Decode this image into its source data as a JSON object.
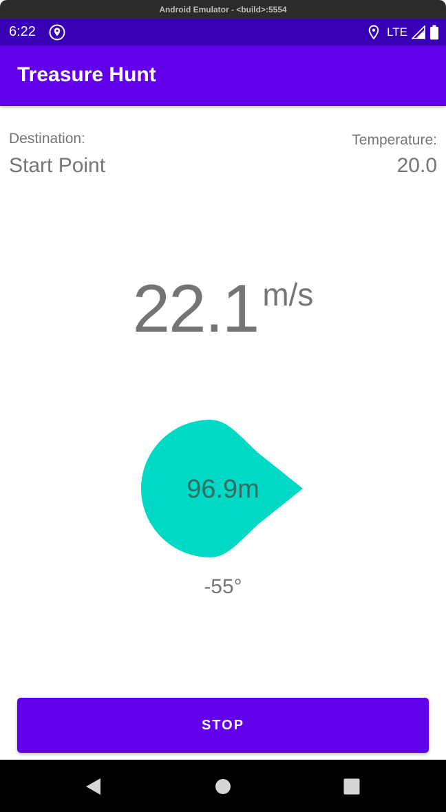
{
  "emulator": {
    "title": "Android Emulator - <build>:5554"
  },
  "status_bar": {
    "time": "6:22",
    "network": "LTE",
    "icons": [
      "location-pin-icon",
      "location-icon",
      "signal-icon",
      "battery-icon"
    ],
    "color": "#3700b3"
  },
  "app_bar": {
    "title": "Treasure Hunt",
    "color": "#6200ea"
  },
  "destination": {
    "label": "Destination:",
    "value": "Start Point"
  },
  "temperature": {
    "label": "Temperature:",
    "value": "20.0"
  },
  "speed": {
    "value": "22.1",
    "unit": "m/s"
  },
  "compass": {
    "distance": "96.9m",
    "bearing": "-55°",
    "color": "#00dac5"
  },
  "stop_button": {
    "label": "STOP",
    "color": "#6200ea"
  },
  "nav_bar": {
    "icons": [
      "back-icon",
      "home-icon",
      "recents-icon"
    ]
  }
}
